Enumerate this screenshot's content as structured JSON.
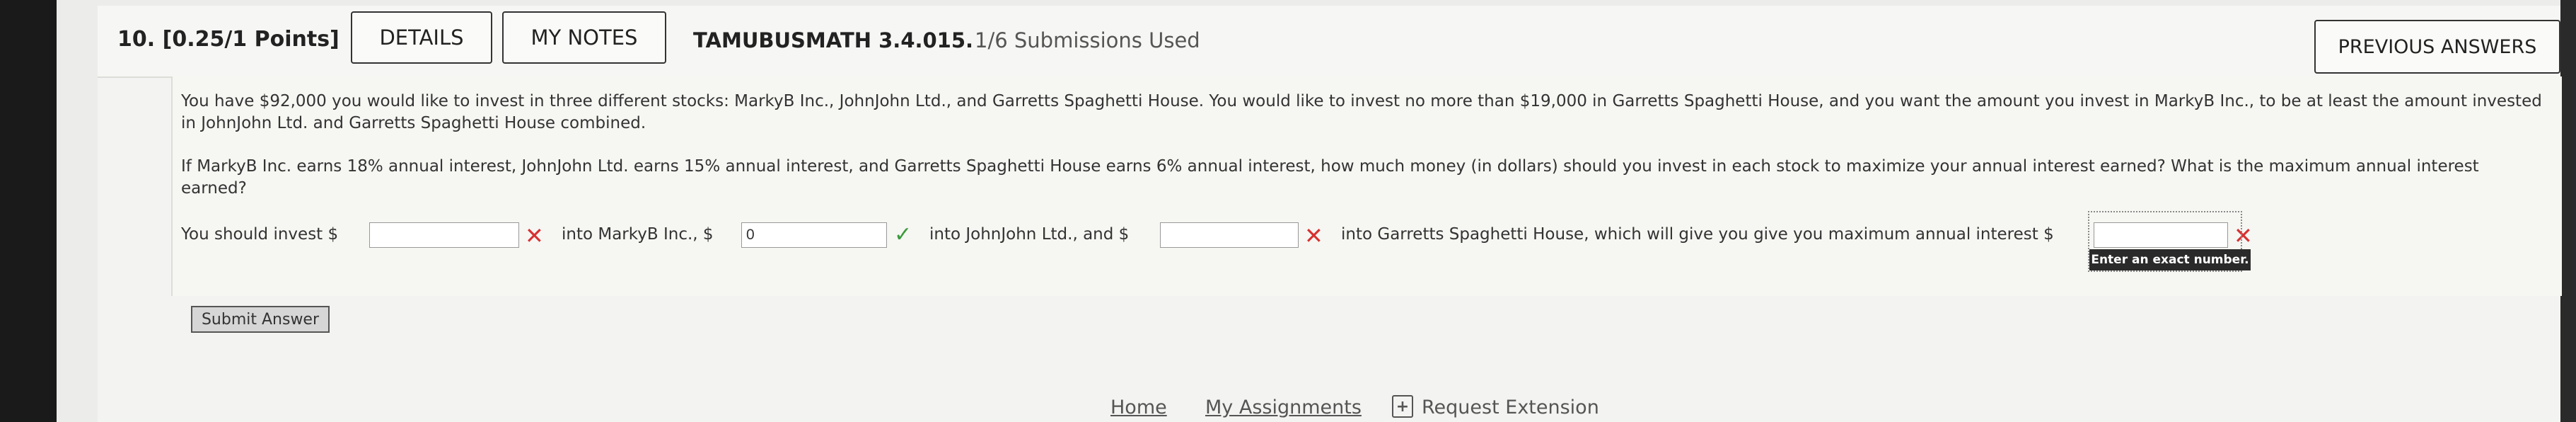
{
  "header": {
    "question_number": "10.",
    "points": "[0.25/1 Points]",
    "details_label": "DETAILS",
    "my_notes_label": "MY NOTES",
    "problem_code": "TAMUBUSMATH 3.4.015.",
    "submissions": "1/6 Submissions Used",
    "previous_answers_label": "PREVIOUS ANSWERS"
  },
  "question": {
    "paragraph1": "You have $92,000 you would like to invest in three different stocks: MarkyB Inc., JohnJohn Ltd., and Garretts Spaghetti House. You would like to invest no more than $19,000 in Garretts Spaghetti House, and you want the amount you invest in MarkyB Inc., to be at least the amount invested in JohnJohn Ltd. and Garretts Spaghetti House combined.",
    "paragraph2": "If MarkyB Inc. earns 18% annual interest, JohnJohn Ltd. earns 15% annual interest, and Garretts Spaghetti House earns 6% annual interest, how much money (in dollars) should you invest in each stock to maximize your annual interest earned? What is the maximum annual interest earned?"
  },
  "answer_row": {
    "text1": "You should invest $",
    "text2": "into MarkyB Inc., $",
    "text3": "into JohnJohn Ltd., and $",
    "text4": "into Garretts Spaghetti House, which will give you give you maximum annual interest $",
    "input1_value": "",
    "input2_value": "0",
    "input3_value": "",
    "input4_value": "",
    "tooltip": "Enter an exact number."
  },
  "submit_label": "Submit Answer",
  "footer": {
    "home": "Home",
    "my_assignments": "My Assignments",
    "request_extension": "Request Extension"
  },
  "colors": {
    "incorrect": "#d83030",
    "correct": "#3a9a3a"
  },
  "icons": [
    "incorrect-x-icon",
    "correct-check-icon",
    "extension-plus-icon"
  ]
}
